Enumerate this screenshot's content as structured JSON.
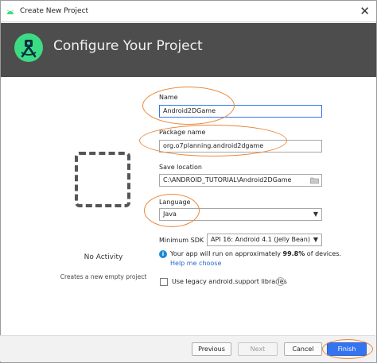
{
  "window": {
    "title": "Create New Project",
    "close_glyph": "✕"
  },
  "header": {
    "title": "Configure Your Project",
    "logo_icon": "android-studio-icon"
  },
  "preview": {
    "title": "No Activity",
    "description": "Creates a new empty project"
  },
  "form": {
    "name_label": "Name",
    "name_value": "Android2DGame",
    "package_label": "Package name",
    "package_value": "org.o7planning.android2dgame",
    "location_label": "Save location",
    "location_value": "C:\\ANDROID_TUTORIAL\\Android2DGame",
    "language_label": "Language",
    "language_value": "Java",
    "min_sdk_label": "Minimum SDK",
    "min_sdk_value": "API 16: Android 4.1 (Jelly Bean)",
    "info_prefix": "Your app will run on approximately ",
    "info_percent": "99.8%",
    "info_suffix": " of devices.",
    "help_link": "Help me choose",
    "legacy_checkbox_label": "Use legacy android.support libraries",
    "legacy_checked": false
  },
  "buttons": {
    "previous": "Previous",
    "next": "Next",
    "cancel": "Cancel",
    "finish": "Finish"
  },
  "colors": {
    "header_bg": "#4d4d4d",
    "accent": "#3574f0",
    "highlight_ellipse": "#e8863a",
    "link": "#2b68c8",
    "logo_green": "#3ddc84"
  }
}
